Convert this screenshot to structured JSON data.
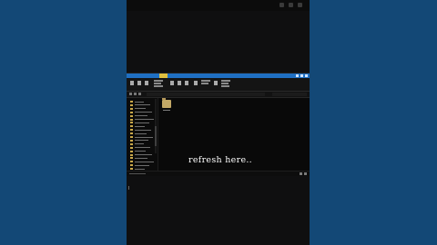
{
  "caption": {
    "text": "refresh here.."
  },
  "explorer": {
    "nav_rows": 20,
    "selected_item_color": "#c2a866"
  },
  "colors": {
    "background": "#134876",
    "title_bar": "#1f6fc2",
    "folder": "#c2a866"
  }
}
